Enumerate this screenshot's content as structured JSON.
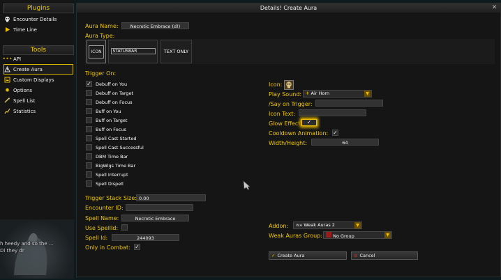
{
  "sidebar": {
    "plugins_header": "Plugins",
    "plugins": [
      {
        "label": "Encounter Details",
        "icon": "skull-icon"
      },
      {
        "label": "Time Line",
        "icon": "play-icon"
      }
    ],
    "tools_header": "Tools",
    "tools": [
      {
        "label": "API",
        "icon": "dots-icon"
      },
      {
        "label": "Create Aura",
        "icon": "aura-icon",
        "active": true
      },
      {
        "label": "Custom Displays",
        "icon": "display-icon"
      },
      {
        "label": "Options",
        "icon": "gear-icon"
      },
      {
        "label": "Spell List",
        "icon": "book-icon"
      },
      {
        "label": "Statistics",
        "icon": "chart-icon"
      }
    ],
    "chat_line_1": "h heedy and so the ...",
    "chat_line_2": "Di they dr"
  },
  "window": {
    "title": "Details! Create Aura",
    "close": "✕"
  },
  "form": {
    "aura_name_label": "Aura Name:",
    "aura_name_value": "Necrotic Embrace (d!)",
    "aura_type_label": "Aura Type:",
    "aura_types": [
      "ICON",
      "STATUSBAR",
      "TEXT ONLY"
    ],
    "trigger_on_label": "Trigger On:",
    "triggers": [
      {
        "label": "Debuff on You",
        "checked": true
      },
      {
        "label": "Debuff on Target",
        "checked": false
      },
      {
        "label": "Debuff on Focus",
        "checked": false
      },
      {
        "label": "Buff on You",
        "checked": false
      },
      {
        "label": "Buff on Target",
        "checked": false
      },
      {
        "label": "Buff on Focus",
        "checked": false
      },
      {
        "label": "Spell Cast Started",
        "checked": false
      },
      {
        "label": "Spell Cast Successful",
        "checked": false
      },
      {
        "label": "DBM Time Bar",
        "checked": false
      },
      {
        "label": "BigWigs Time Bar",
        "checked": false
      },
      {
        "label": "Spell Interrupt",
        "checked": false
      },
      {
        "label": "Spell Dispell",
        "checked": false
      }
    ],
    "trigger_stack_label": "Trigger Stack Size:",
    "trigger_stack_value": "0.00",
    "encounter_id_label": "Encounter ID:",
    "encounter_id_value": "",
    "spell_name_label": "Spell Name:",
    "spell_name_value": "Necrotic Embrace",
    "use_spellid_label": "Use SpellId:",
    "spell_id_label": "Spell Id:",
    "spell_id_value": "244093",
    "only_combat_label": "Only in Combat:",
    "icon_label": "Icon:",
    "play_sound_label": "Play Sound:",
    "play_sound_value": "Air Horn",
    "say_trigger_label": "/Say on Trigger:",
    "say_trigger_value": "",
    "icon_text_label": "Icon Text:",
    "icon_text_value": "",
    "glow_label": "Glow Effect:",
    "cooldown_anim_label": "Cooldown Animation:",
    "width_height_label": "Width/Height:",
    "width_height_value": "64",
    "addon_label": "Addon:",
    "addon_value": "Weak Auras 2",
    "wa_group_label": "Weak Auras Group:",
    "wa_group_value": "No Group",
    "create_button": "Create Aura",
    "cancel_button": "Cancel"
  },
  "colors": {
    "label_yellow": "#f0c800",
    "background": "#151515",
    "accent_border": "#d6b400",
    "glow": "#f0c000"
  }
}
